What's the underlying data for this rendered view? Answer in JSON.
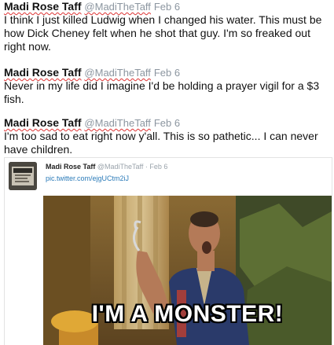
{
  "tweets": [
    {
      "name": "Madi Rose Taff",
      "handle": "@MadiTheTaff",
      "date": "Feb 6",
      "text": "I think I just killed Ludwig when I changed his water. This must be how Dick Cheney felt when he shot that guy. I'm so freaked out right now."
    },
    {
      "name": "Madi Rose Taff",
      "handle": "@MadiTheTaff",
      "date": "Feb 6",
      "text": "Never in my life did I imagine I'd be holding a prayer vigil for a $3 fish."
    },
    {
      "name": "Madi Rose Taff",
      "handle": "@MadiTheTaff",
      "date": "Feb 6",
      "text": "I'm too sad to eat right now y'all. This is so pathetic... I can never have children."
    }
  ],
  "embed": {
    "name": "Madi Rose Taff",
    "handle": "@MadiTheTaff",
    "separator": "·",
    "date": "Feb 6",
    "link": "pic.twitter.com/ejgUCtm2iJ",
    "photo_caption": "I'M A MONSTER!"
  }
}
